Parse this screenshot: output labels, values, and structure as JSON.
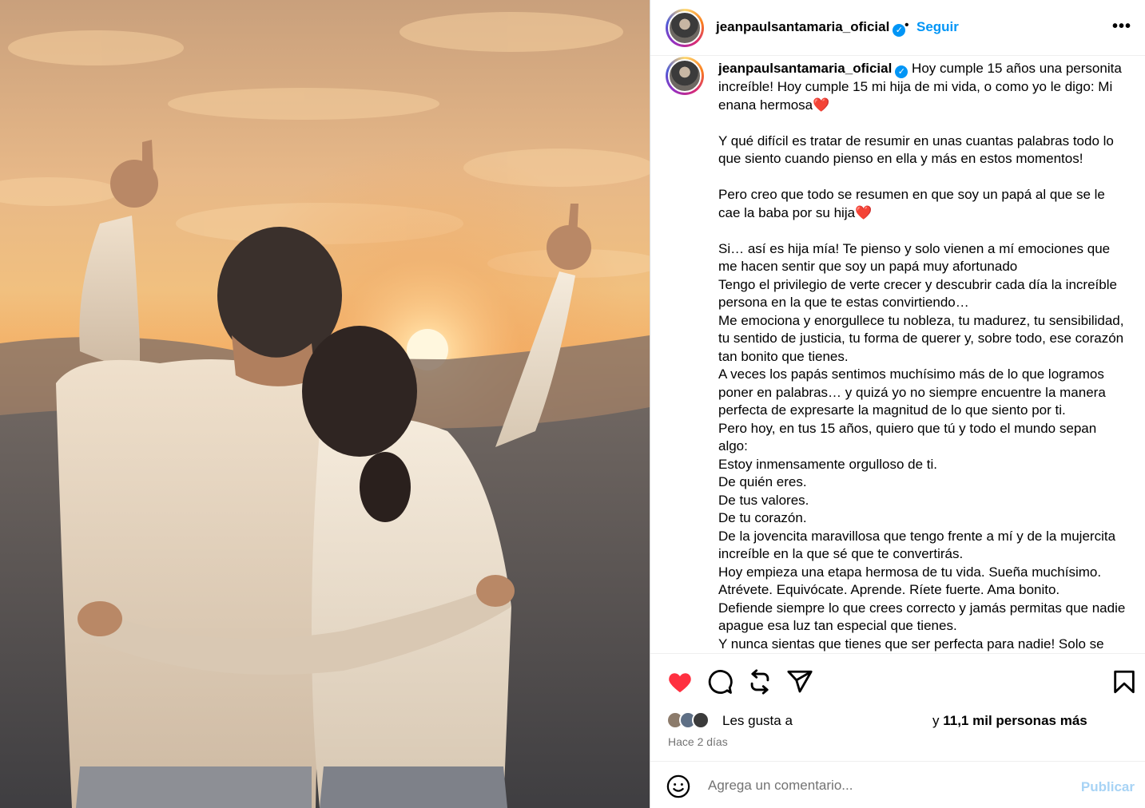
{
  "post": {
    "username": "jeanpaulsantamaria_oficial",
    "separator": "•",
    "follow_label": "Seguir",
    "more_label": "•••",
    "verified_mark": "✓"
  },
  "caption": {
    "username": "jeanpaulsantamaria_oficial",
    "text": " Hoy cumple 15 años una personita increíble! Hoy cumple 15 mi hija de mi vida, o como yo le digo: Mi enana hermosa❤️\n\nY qué difícil es tratar de resumir en unas cuantas palabras todo lo que siento cuando pienso en ella y más en estos momentos!\n\nPero creo que todo se resumen en que soy un papá al que se le cae la baba por su hija❤️\n\nSi… así es hija mía! Te pienso y solo vienen a mí emociones que me hacen sentir que soy un papá muy afortunado\nTengo el privilegio de verte crecer y descubrir cada día la increíble persona en la que te estas convirtiendo…\nMe emociona y enorgullece tu nobleza, tu madurez, tu sensibilidad, tu sentido de justicia, tu forma de querer y, sobre todo, ese corazón tan bonito que tienes.\nA veces los papás sentimos muchísimo más de lo que logramos poner en palabras… y quizá yo no siempre encuentre la manera perfecta de expresarte la magnitud de lo que siento por ti.\nPero hoy, en tus 15 años, quiero que tú y todo el mundo sepan algo:\nEstoy inmensamente orgulloso de ti.\nDe quién eres.\nDe tus valores.\nDe tu corazón.\nDe la jovencita maravillosa que tengo frente a mí y de la mujercita increíble en la que sé que te convertirás.\nHoy empieza una etapa hermosa de tu vida. Sueña muchísimo. Atrévete. Equivócate. Aprende. Ríete fuerte. Ama bonito.\nDefiende siempre lo que crees correcto y jamás permitas que nadie apague esa luz tan especial que tienes.\nY nunca sientas que tienes que ser perfecta para nadie! Solo se"
  },
  "actions": {
    "like_icon": "heart-filled-icon",
    "comment_icon": "comment-icon",
    "repost_icon": "repost-icon",
    "share_icon": "share-icon",
    "save_icon": "bookmark-icon",
    "like_color": "#ff3040"
  },
  "likes": {
    "prefix": "Les gusta a",
    "suffix_pre": "y ",
    "count": "11,1 mil personas más"
  },
  "timestamp": "Hace 2 días",
  "comment": {
    "placeholder": "Agrega un comentario...",
    "publish_label": "Publicar"
  },
  "colors": {
    "accent": "#0095f6",
    "publish_disabled": "#a7d3f5",
    "secondary_text": "#737373"
  }
}
